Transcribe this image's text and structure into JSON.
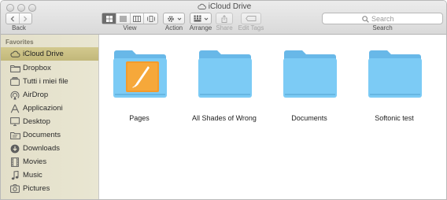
{
  "window": {
    "title": "iCloud Drive"
  },
  "toolbar": {
    "back_label": "Back",
    "view_label": "View",
    "action_label": "Action",
    "arrange_label": "Arrange",
    "share_label": "Share",
    "edit_tags_label": "Edit Tags",
    "search_label": "Search",
    "search_placeholder": "Search",
    "active_view": "icon-view"
  },
  "sidebar": {
    "heading": "Favorites",
    "items": [
      {
        "label": "iCloud Drive",
        "icon": "cloud-icon",
        "selected": true
      },
      {
        "label": "Dropbox",
        "icon": "folder-icon"
      },
      {
        "label": "Tutti i miei file",
        "icon": "all-files-icon"
      },
      {
        "label": "AirDrop",
        "icon": "airdrop-icon"
      },
      {
        "label": "Applicazioni",
        "icon": "applications-icon"
      },
      {
        "label": "Desktop",
        "icon": "desktop-icon"
      },
      {
        "label": "Documents",
        "icon": "documents-icon"
      },
      {
        "label": "Downloads",
        "icon": "downloads-icon"
      },
      {
        "label": "Movies",
        "icon": "movies-icon"
      },
      {
        "label": "Music",
        "icon": "music-icon"
      },
      {
        "label": "Pictures",
        "icon": "pictures-icon"
      }
    ]
  },
  "files": [
    {
      "name": "Pages",
      "icon": "pages-folder-icon"
    },
    {
      "name": "All Shades of Wrong",
      "icon": "folder-icon"
    },
    {
      "name": "Documents",
      "icon": "folder-icon"
    },
    {
      "name": "Softonic test",
      "icon": "folder-icon"
    }
  ],
  "colors": {
    "folder_blue": "#6cc4f4",
    "sidebar_selection": "#c8bf80",
    "pages_orange": "#f39b2c"
  }
}
